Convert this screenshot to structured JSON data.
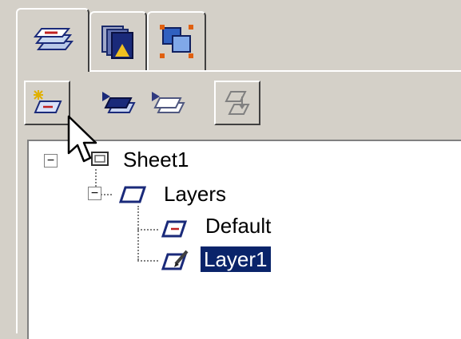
{
  "tabs": [
    {
      "name": "layers-tab-icon",
      "active": true
    },
    {
      "name": "views-tab-icon",
      "active": false
    },
    {
      "name": "groups-tab-icon",
      "active": false
    }
  ],
  "toolbar": [
    {
      "name": "new-layer-icon",
      "enabled": true
    },
    {
      "name": "show-layer-icon",
      "enabled": true
    },
    {
      "name": "hide-layer-icon",
      "enabled": true
    },
    {
      "name": "move-layer-icon",
      "enabled": false
    }
  ],
  "tree": {
    "sheet": {
      "label": "Sheet1",
      "expander": "−"
    },
    "layers": {
      "label": "Layers",
      "expander": "−"
    },
    "items": [
      {
        "label": "Default",
        "selected": false
      },
      {
        "label": "Layer1",
        "selected": true
      }
    ]
  },
  "colors": {
    "selection": "#0a246a",
    "window_bg": "#d4d0c8",
    "tree_bg": "#ffffff"
  }
}
